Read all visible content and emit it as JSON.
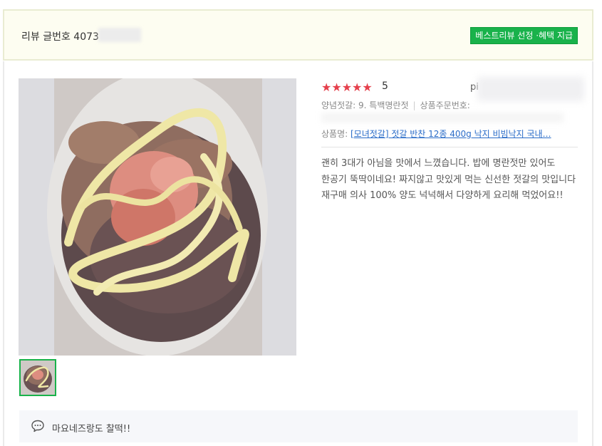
{
  "header": {
    "review_label": "리뷰 글번호 4073",
    "best_badge": "베스트리뷰 선정 ·혜택 지급"
  },
  "rating": {
    "stars_text": "★★★★★",
    "score": "5",
    "user_prefix": "pi"
  },
  "option": {
    "label": "양념젓갈: 9. 특백명란젓",
    "order_label": "상품주문번호:"
  },
  "product": {
    "label": "상품명:",
    "name": "[모녀젓갈] 젓갈 반찬 12종 400g 낙지 비빔낙지 국내…"
  },
  "review": {
    "text": "괜히 3대가 아님을 맛에서 느꼈습니다. 밥에 명란젓만 있어도 한공기 뚝딱이네요! 짜지않고 맛있게 먹는 신선한 젓갈의 맛입니다 재구매 의사 100% 양도 넉넉해서 다양하게 요리해 먹었어요!!"
  },
  "comment": {
    "text": "마요네즈랑도 찰떡!!"
  },
  "colors": {
    "badge": "#19b24b",
    "stars": "#e5404c",
    "link": "#2a6cc8",
    "header_bg": "#fdfdf1"
  }
}
